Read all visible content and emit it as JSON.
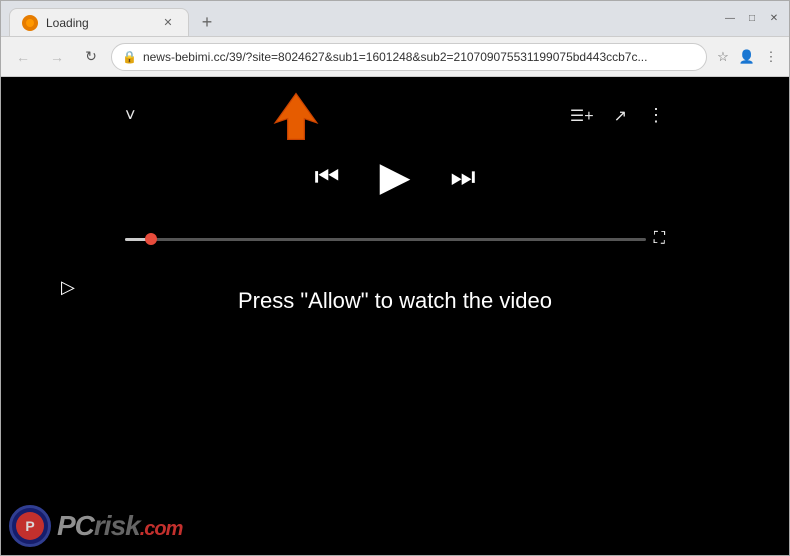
{
  "browser": {
    "tab": {
      "title": "Loading",
      "favicon_color": "#e67c00"
    },
    "new_tab_label": "+",
    "window_controls": {
      "minimize": "—",
      "maximize": "□",
      "close": "✕"
    },
    "nav": {
      "back": "←",
      "forward": "→",
      "refresh": "↻"
    },
    "address_bar": {
      "url": "news-bebimi.cc/39/?site=8024627&sub1=1601248&sub2=210709075531199075bd443ccb7c...",
      "lock_icon": "🔒"
    },
    "toolbar_icons": {
      "star": "☆",
      "profile": "👤",
      "menu": "⋮"
    }
  },
  "player": {
    "top_controls": {
      "chevron": "˅",
      "playlist": "≡+",
      "share": "↗",
      "more": "⋮"
    },
    "main_controls": {
      "prev": "⏮",
      "play": "▶",
      "next": "⏭"
    },
    "progress": {
      "fill_percent": 5
    },
    "fullscreen": "⛶"
  },
  "page": {
    "press_allow_text": "Press \"Allow\" to watch the video"
  },
  "watermark": {
    "text": "PC",
    "risk": "risk",
    "dotcom": ".com"
  }
}
